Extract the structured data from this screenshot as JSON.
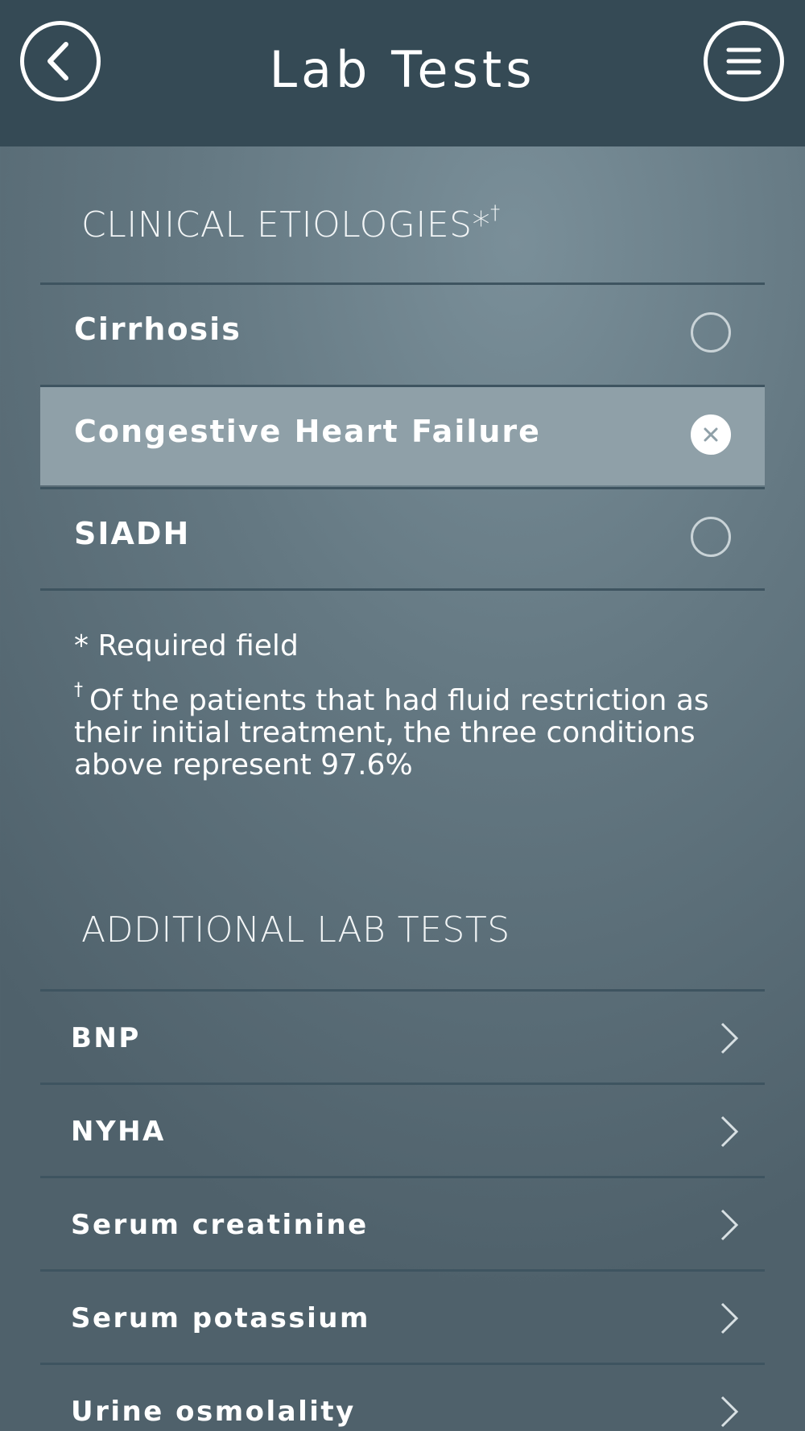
{
  "header": {
    "title": "Lab Tests",
    "back_icon": "back-arrow-icon",
    "menu_icon": "menu-icon"
  },
  "etiologies": {
    "title": "CLINICAL ETIOLOGIES*",
    "title_sup": "†",
    "items": [
      {
        "label": "Cirrhosis",
        "selected": false
      },
      {
        "label": "Congestive Heart Failure",
        "selected": true
      },
      {
        "label": "SIADH",
        "selected": false
      }
    ]
  },
  "notes": {
    "required": "* Required field",
    "dagger": "†",
    "footnote": "Of the patients that had fluid restriction as their initial treatment, the three conditions above represent 97.6%"
  },
  "lab_tests": {
    "title": "ADDITIONAL LAB TESTS",
    "items": [
      {
        "label": "BNP"
      },
      {
        "label": "NYHA"
      },
      {
        "label": "Serum creatinine"
      },
      {
        "label": "Serum potassium"
      },
      {
        "label": "Urine osmolality"
      }
    ]
  },
  "colors": {
    "header_bg": "#354a55",
    "selected_row_bg": "#8fa0a8",
    "divider": "#3e5460"
  }
}
